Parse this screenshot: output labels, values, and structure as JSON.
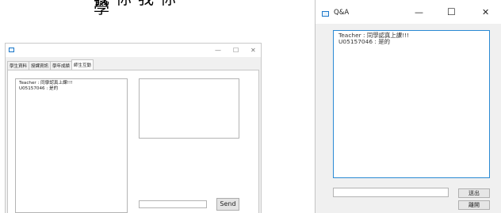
{
  "heading_fragment": "我你我你學",
  "left_window": {
    "title": "",
    "controls": {
      "minimize": "—",
      "maximize": "☐",
      "close": "✕"
    },
    "tabs": [
      {
        "label": "學生資料"
      },
      {
        "label": "授課資訊"
      },
      {
        "label": "學年成績"
      },
      {
        "label": "師生互動",
        "active": true
      }
    ],
    "chat_lines": [
      "Teacher : 同學認真上課!!!",
      "U05157046 : 是的"
    ],
    "send_label": "Send",
    "send_input_value": ""
  },
  "right_window": {
    "title": "Q&A",
    "controls": {
      "minimize": "—",
      "maximize": "☐",
      "close": "✕"
    },
    "chat_lines": [
      "Teacher : 同學認真上課!!!",
      "U05157046 : 是的"
    ],
    "input_value": "",
    "send_label": "送出",
    "leave_label": "離開",
    "accent": "#2a8ad4"
  }
}
